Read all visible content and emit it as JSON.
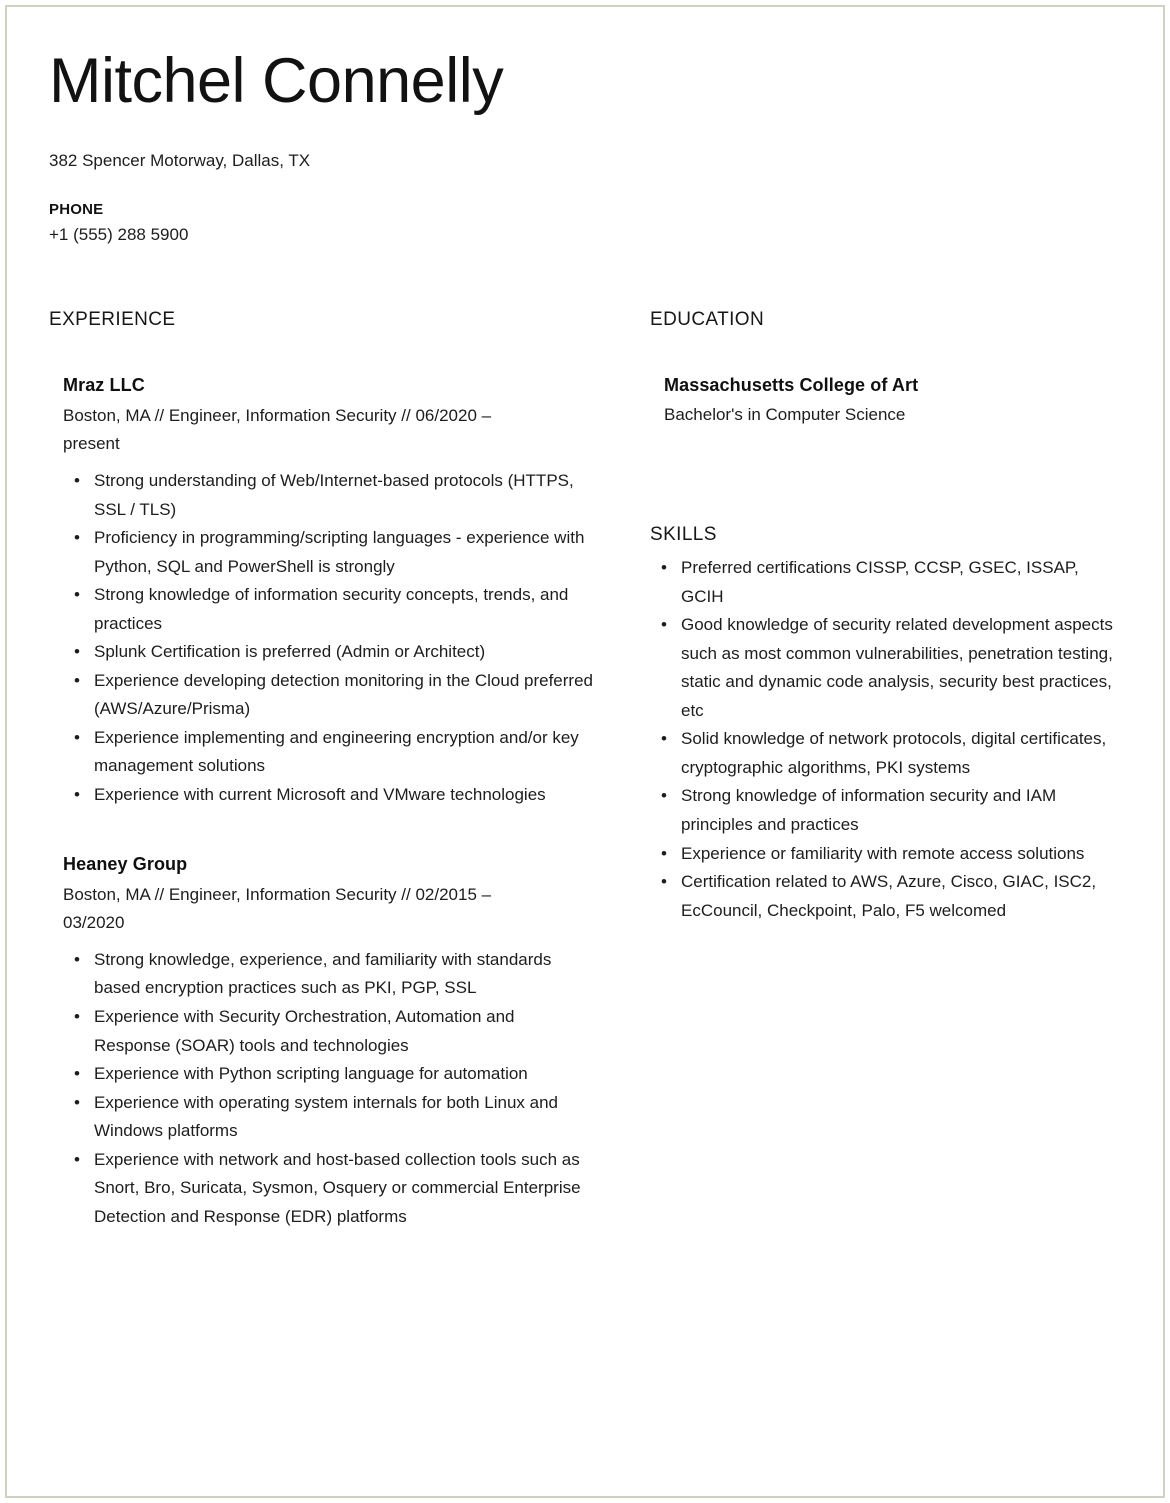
{
  "header": {
    "name": "Mitchel Connelly",
    "address": "382 Spencer Motorway, Dallas, TX",
    "phone_label": "PHONE",
    "phone_value": "+1 (555) 288 5900"
  },
  "experience": {
    "section_title": "EXPERIENCE",
    "entries": [
      {
        "company": "Mraz LLC",
        "meta": "Boston, MA // Engineer, Information Security // 06/2020 – present",
        "bullets": [
          "Strong understanding of Web/Internet-based protocols (HTTPS, SSL / TLS)",
          "Proficiency in programming/scripting languages - experience with Python, SQL and PowerShell is strongly",
          "Strong knowledge of information security concepts, trends, and practices",
          "Splunk Certification is preferred (Admin or Architect)",
          "Experience developing detection monitoring in the Cloud preferred (AWS/Azure/Prisma)",
          "Experience implementing and engineering encryption and/or key management solutions",
          "Experience with current Microsoft and VMware technologies"
        ]
      },
      {
        "company": "Heaney Group",
        "meta": "Boston, MA // Engineer, Information Security // 02/2015 – 03/2020",
        "bullets": [
          "Strong knowledge, experience, and familiarity with standards based encryption practices such as PKI, PGP, SSL",
          "Experience with Security Orchestration, Automation and Response (SOAR) tools and technologies",
          "Experience with Python scripting language for automation",
          "Experience with operating system internals for both Linux and Windows platforms",
          "Experience with network and host-based collection tools such as Snort, Bro, Suricata, Sysmon, Osquery or commercial Enterprise Detection and Response (EDR) platforms"
        ]
      }
    ]
  },
  "education": {
    "section_title": "EDUCATION",
    "entries": [
      {
        "school": "Massachusetts College of Art",
        "degree": "Bachelor's in Computer Science"
      }
    ]
  },
  "skills": {
    "section_title": "SKILLS",
    "bullets": [
      "Preferred certifications CISSP, CCSP, GSEC, ISSAP, GCIH",
      "Good knowledge of security related development aspects such as most common vulnerabilities, penetration testing, static and dynamic code analysis, security best practices, etc",
      "Solid knowledge of network protocols, digital certificates, cryptographic algorithms, PKI systems",
      "Strong knowledge of information security and IAM principles and practices",
      "Experience or familiarity with remote access solutions",
      "Certification related to AWS, Azure, Cisco, GIAC, ISC2, EcCouncil, Checkpoint, Palo, F5 welcomed"
    ]
  },
  "theme": {
    "page_background": "#ffffff",
    "border_color": "#cfd1c2",
    "text_color": "#1d1d1d",
    "heading_color": "#121212"
  }
}
